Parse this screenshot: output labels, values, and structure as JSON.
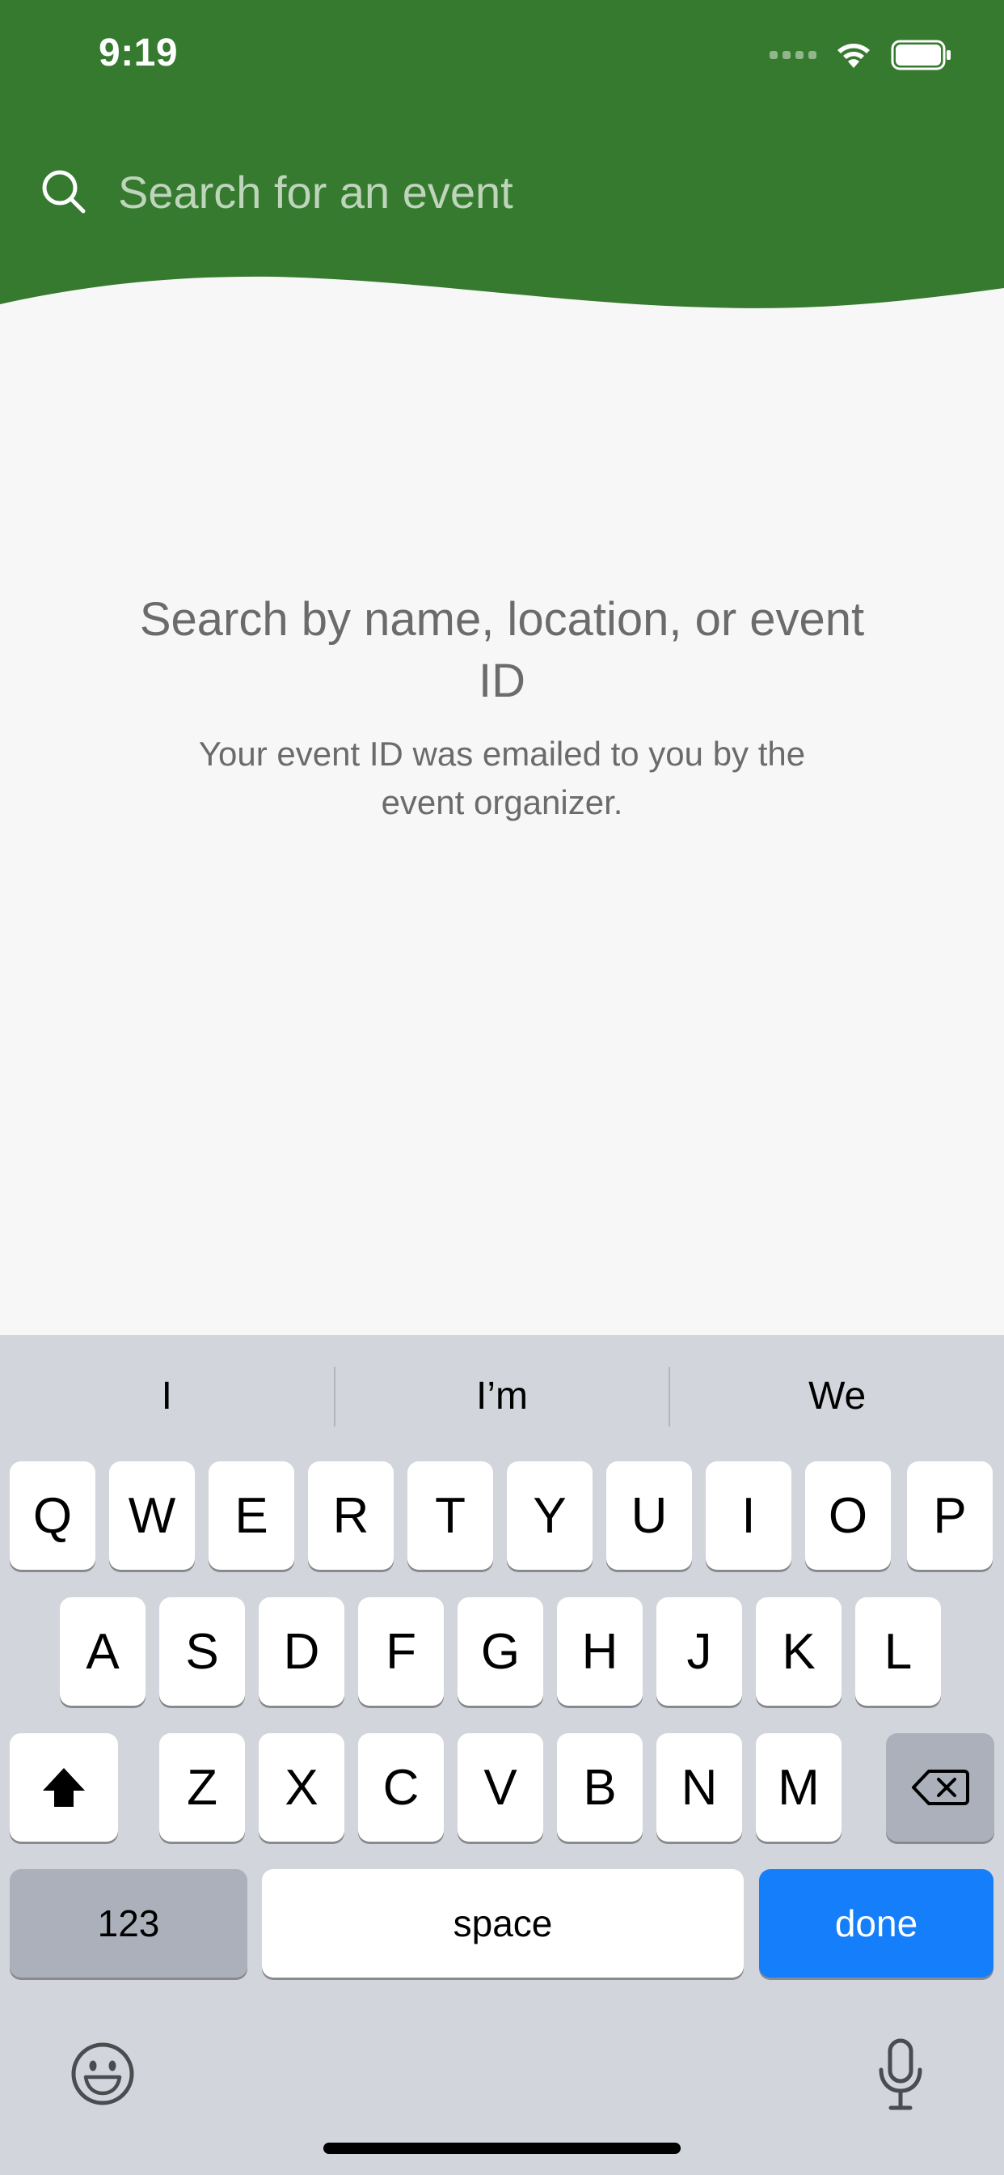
{
  "status_bar": {
    "time": "9:19"
  },
  "search": {
    "placeholder": "Search for an event",
    "value": ""
  },
  "empty_state": {
    "title": "Search by name, location, or event ID",
    "subtitle": "Your event ID was emailed to you by the event organizer."
  },
  "keyboard": {
    "suggestions": [
      "I",
      "I’m",
      "We"
    ],
    "row1": [
      "Q",
      "W",
      "E",
      "R",
      "T",
      "Y",
      "U",
      "I",
      "O",
      "P"
    ],
    "row2": [
      "A",
      "S",
      "D",
      "F",
      "G",
      "H",
      "J",
      "K",
      "L"
    ],
    "row3": [
      "Z",
      "X",
      "C",
      "V",
      "B",
      "N",
      "M"
    ],
    "numbers_label": "123",
    "space_label": "space",
    "done_label": "done"
  },
  "colors": {
    "header_green": "#357a2e",
    "done_blue": "#157efb",
    "keyboard_bg": "#d2d5db"
  },
  "icons": {
    "search": "search-icon",
    "wifi": "wifi-icon",
    "battery": "battery-icon",
    "shift": "shift-icon",
    "backspace": "backspace-icon",
    "emoji": "emoji-icon",
    "microphone": "microphone-icon"
  }
}
